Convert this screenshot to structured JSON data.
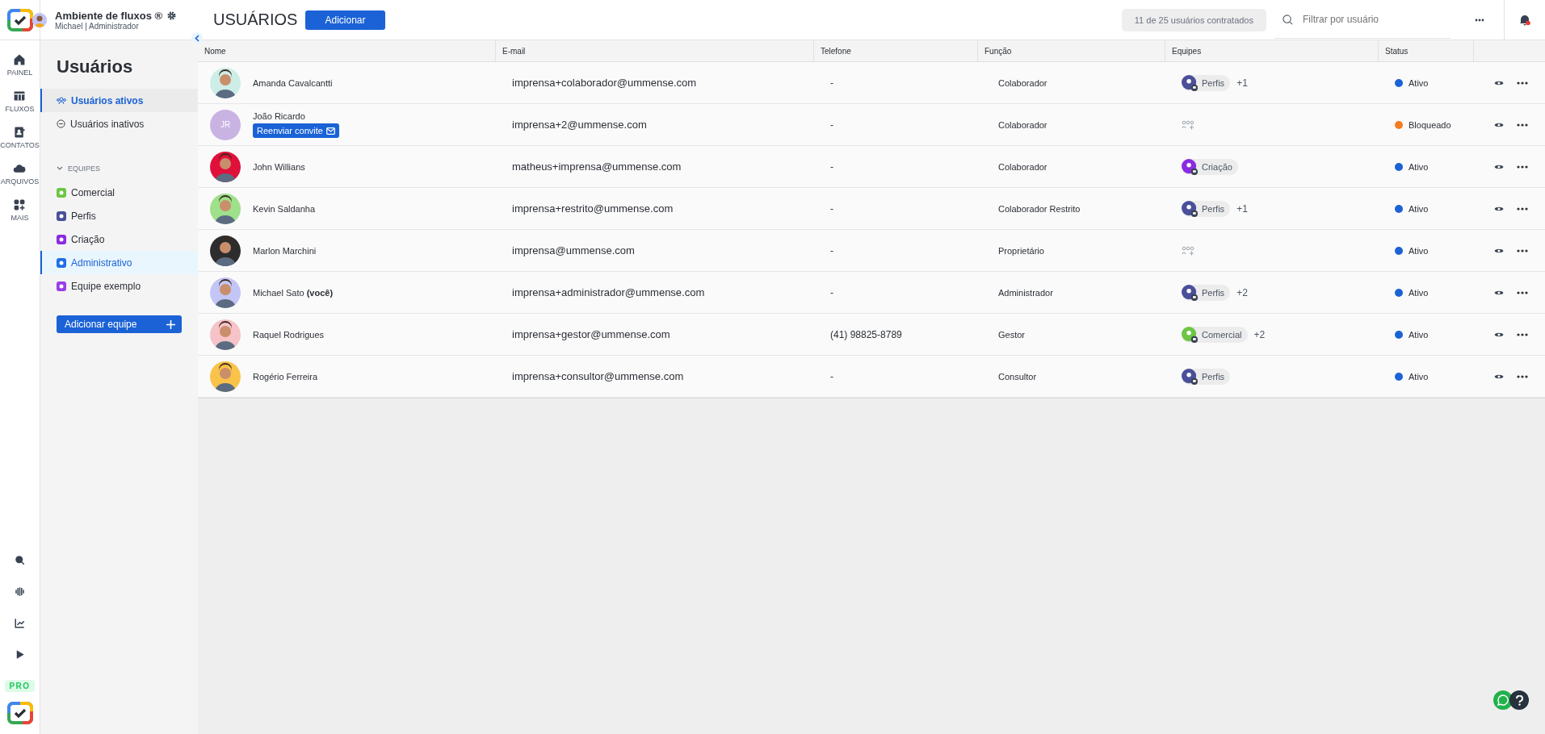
{
  "workspace": {
    "name": "Ambiente de fluxos ®",
    "user": "Michael | Administrador"
  },
  "rail": {
    "items": [
      {
        "label": "PAINEL"
      },
      {
        "label": "FLUXOS"
      },
      {
        "label": "CONTATOS"
      },
      {
        "label": "ARQUIVOS"
      },
      {
        "label": "MAIS"
      }
    ],
    "badge": "PRO"
  },
  "sidebar": {
    "title": "Usuários",
    "nav": [
      {
        "label": "Usuários ativos",
        "selected": true
      },
      {
        "label": "Usuários inativos",
        "selected": false
      }
    ],
    "teams_header": "EQUIPES",
    "teams_expanded": true,
    "teams": [
      {
        "label": "Comercial",
        "color": "#6cc644",
        "selected": false
      },
      {
        "label": "Perfis",
        "color": "#4b4f9a",
        "selected": false
      },
      {
        "label": "Criação",
        "color": "#8b2be2",
        "selected": false
      },
      {
        "label": "Administrativo",
        "color": "#1e6ee8",
        "selected": true
      },
      {
        "label": "Equipe exemplo",
        "color": "#9b3de8",
        "selected": false
      }
    ],
    "add_button": "Adicionar equipe"
  },
  "header": {
    "title": "USUÁRIOS",
    "add_button": "Adicionar",
    "quota": "11 de 25 usuários contratados",
    "search": {
      "placeholder": "Filtrar por usuário"
    },
    "notification": true
  },
  "table": {
    "columns": [
      "Nome",
      "E-mail",
      "Telefone",
      "Função",
      "Equipes",
      "Status"
    ],
    "rows": [
      {
        "name": "Amanda Cavalcantti",
        "email": "imprensa+colaborador@ummense.com",
        "phone": "-",
        "role": "Colaborador",
        "team": {
          "name": "Perfis",
          "color": "#4b4f9a"
        },
        "more_teams": "+1",
        "status": {
          "label": "Ativo",
          "color": "#1a62d6"
        }
      },
      {
        "avatar": {
          "kind": "initials",
          "text": "JR",
          "color": "#c9b3e3"
        },
        "name": "João Ricardo",
        "invite_button": "Reenviar convite",
        "email": "imprensa+2@ummense.com",
        "phone": "-",
        "role": "Colaborador",
        "status": {
          "label": "Bloqueado",
          "color": "#f57c1f"
        }
      },
      {
        "name": "John Willians",
        "email": "matheus+imprensa@ummense.com",
        "phone": "-",
        "role": "Colaborador",
        "team": {
          "name": "Criação",
          "color": "#8b2be2"
        },
        "status": {
          "label": "Ativo",
          "color": "#1a62d6"
        }
      },
      {
        "name": "Kevin Saldanha",
        "email": "imprensa+restrito@ummense.com",
        "phone": "-",
        "role": "Colaborador Restrito",
        "team": {
          "name": "Perfis",
          "color": "#4b4f9a"
        },
        "more_teams": "+1",
        "status": {
          "label": "Ativo",
          "color": "#1a62d6"
        }
      },
      {
        "name": "Marlon Marchini",
        "email": "imprensa@ummense.com",
        "phone": "-",
        "role": "Proprietário",
        "status": {
          "label": "Ativo",
          "color": "#1a62d6"
        }
      },
      {
        "name": "Michael Sato **(você)**",
        "email": "imprensa+administrador@ummense.com",
        "phone": "-",
        "role": "Administrador",
        "team": {
          "name": "Perfis",
          "color": "#4b4f9a"
        },
        "more_teams": "+2",
        "status": {
          "label": "Ativo",
          "color": "#1a62d6"
        }
      },
      {
        "name": "Raquel Rodrigues",
        "email": "imprensa+gestor@ummense.com",
        "phone": "(41) 98825-8789",
        "role": "Gestor",
        "team": {
          "name": "Comercial",
          "color": "#6cc644"
        },
        "more_teams": "+2",
        "status": {
          "label": "Ativo",
          "color": "#1a62d6"
        }
      },
      {
        "name": "Rogério Ferreira",
        "email": "imprensa+consultor@ummense.com",
        "phone": "-",
        "role": "Consultor",
        "team": {
          "name": "Perfis",
          "color": "#4b4f9a"
        },
        "status": {
          "label": "Ativo",
          "color": "#1a62d6"
        }
      }
    ]
  }
}
